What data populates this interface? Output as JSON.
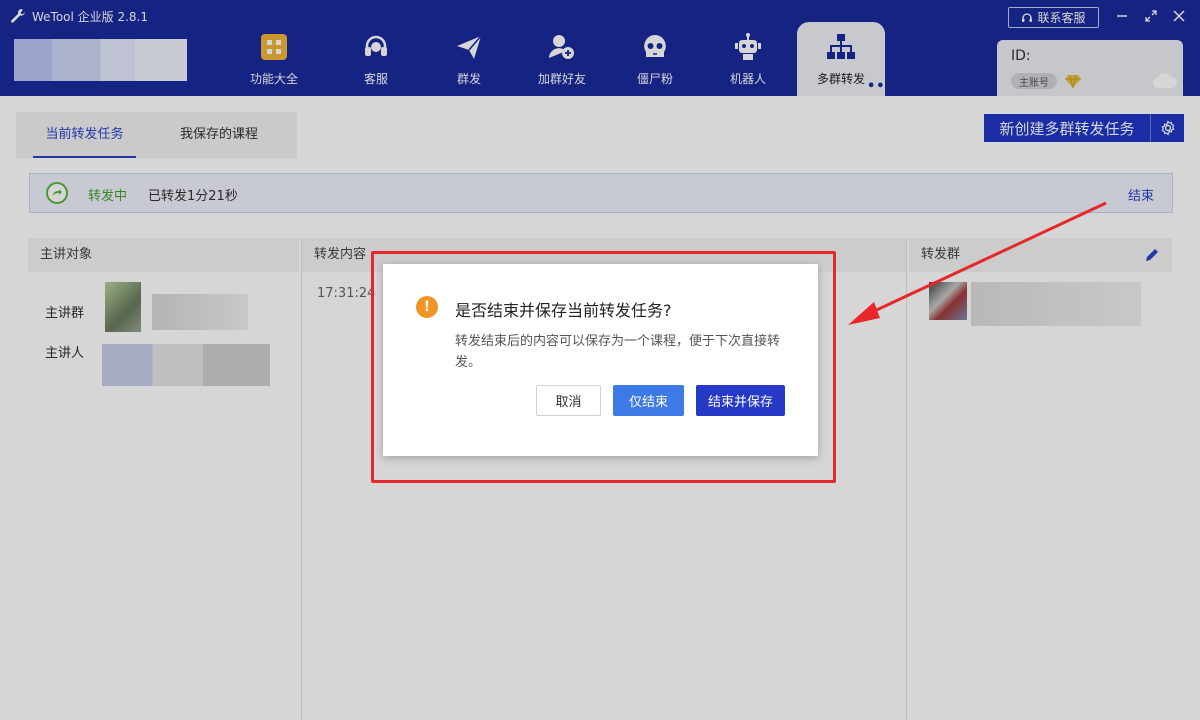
{
  "app": {
    "title": "WeTool 企业版 2.8.1",
    "contact_label": "联系客服"
  },
  "nav": [
    {
      "label": "功能大全",
      "icon": "grid-icon"
    },
    {
      "label": "客服",
      "icon": "headset-icon"
    },
    {
      "label": "群发",
      "icon": "send-icon"
    },
    {
      "label": "加群好友",
      "icon": "add-user-icon"
    },
    {
      "label": "僵尸粉",
      "icon": "skull-icon"
    },
    {
      "label": "机器人",
      "icon": "robot-icon"
    },
    {
      "label": "多群转发",
      "icon": "network-icon",
      "active": true
    }
  ],
  "account": {
    "id_label": "ID:",
    "badge": "主账号"
  },
  "tabs": [
    {
      "label": "当前转发任务",
      "active": true
    },
    {
      "label": "我保存的课程"
    }
  ],
  "toolbar": {
    "new_task_label": "新创建多群转发任务"
  },
  "status": {
    "state": "转发中",
    "elapsed": "已转发1分21秒",
    "end_label": "结束"
  },
  "columns": {
    "lecturer": "主讲对象",
    "content": "转发内容",
    "groups": "转发群"
  },
  "lecturer": {
    "group_label": "主讲群",
    "person_label": "主讲人"
  },
  "content": {
    "first_time": "17:31:24"
  },
  "dialog": {
    "title": "是否结束并保存当前转发任务?",
    "body": "转发结束后的内容可以保存为一个课程，便于下次直接转发。",
    "cancel": "取消",
    "end_only": "仅结束",
    "end_and_save": "结束并保存"
  },
  "colors": {
    "header_bg": "#1a2a9c",
    "accent": "#2a43c9",
    "status_green": "#44a030",
    "annotation_red": "#e8272a"
  }
}
